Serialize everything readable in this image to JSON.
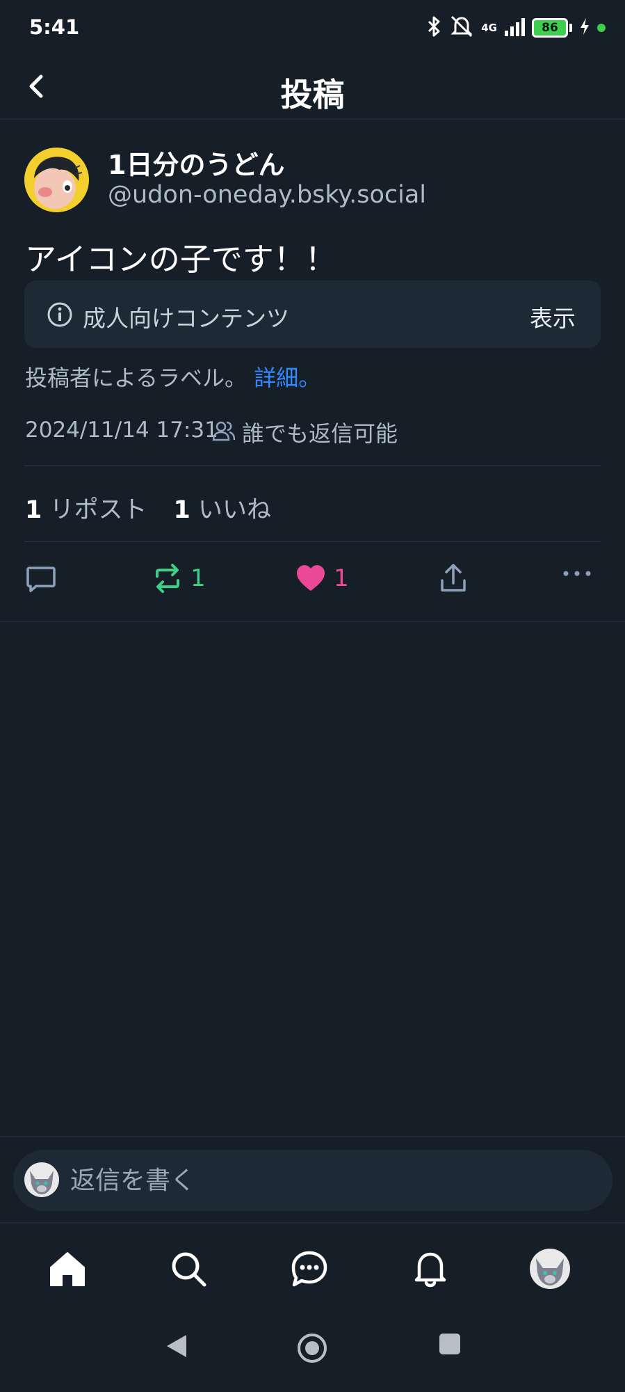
{
  "status_bar": {
    "time": "5:41",
    "network": "4G",
    "battery": "86"
  },
  "header": {
    "title": "投稿"
  },
  "post": {
    "display_name": "1日分のうどん",
    "handle": "@udon-oneday.bsky.social",
    "text": "アイコンの子です！！",
    "content_warning": {
      "label": "成人向けコンテンツ",
      "show_label": "表示"
    },
    "label_note": "投稿者によるラベル。",
    "label_note_link": "詳細。",
    "timestamp": "2024/11/14 17:31",
    "reply_setting": "誰でも返信可能",
    "repost_count": "1",
    "repost_label": "リポスト",
    "like_count": "1",
    "like_label": "いいね",
    "actions": {
      "repost_count": "1",
      "like_count": "1"
    }
  },
  "composer": {
    "placeholder": "返信を書く"
  },
  "colors": {
    "background": "#161e27",
    "panel": "#1e2936",
    "repost_green": "#3ed089",
    "like_pink": "#ec4899",
    "link_blue": "#2f8bff",
    "muted_text": "#aebbc9"
  },
  "icons": [
    "chevron-left-icon",
    "info-icon",
    "people-icon",
    "reply-icon",
    "repost-icon",
    "heart-icon",
    "share-icon",
    "more-icon",
    "home-icon",
    "search-icon",
    "chat-icon",
    "bell-icon"
  ]
}
